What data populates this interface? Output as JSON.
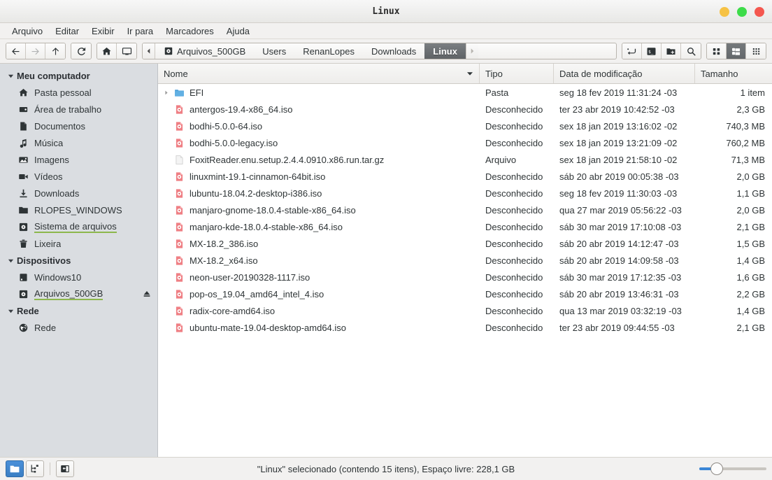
{
  "window": {
    "title": "Linux",
    "controls": [
      {
        "name": "minimize-button",
        "color": "#f6c244"
      },
      {
        "name": "maximize-button",
        "color": "#3ddc4a"
      },
      {
        "name": "close-button",
        "color": "#f4574f"
      }
    ]
  },
  "menubar": {
    "items": [
      {
        "label": "Arquivo"
      },
      {
        "label": "Editar"
      },
      {
        "label": "Exibir"
      },
      {
        "label": "Ir para"
      },
      {
        "label": "Marcadores"
      },
      {
        "label": "Ajuda"
      }
    ]
  },
  "toolbar": {
    "nav": [
      {
        "name": "back-button",
        "icon": "arrow-left-icon",
        "disabled": false
      },
      {
        "name": "forward-button",
        "icon": "arrow-right-icon",
        "disabled": true
      },
      {
        "name": "up-button",
        "icon": "arrow-up-icon",
        "disabled": false
      }
    ],
    "reload": {
      "name": "reload-button",
      "icon": "reload-icon"
    },
    "places": [
      {
        "name": "home-button",
        "icon": "home-icon"
      },
      {
        "name": "desktop-button",
        "icon": "monitor-icon"
      }
    ],
    "breadcrumb": {
      "left_arrow": "chevron-left-icon",
      "right_arrow": "chevron-right-icon",
      "crumbs": [
        {
          "label": "Arquivos_500GB",
          "icon": "drive-icon",
          "current": false
        },
        {
          "label": "Users",
          "icon": "",
          "current": false
        },
        {
          "label": "RenanLopes",
          "icon": "",
          "current": false
        },
        {
          "label": "Downloads",
          "icon": "",
          "current": false
        },
        {
          "label": "Linux",
          "icon": "",
          "current": true
        }
      ]
    },
    "actions": [
      {
        "name": "toggle-location-entry-button",
        "icon": "path-entry-icon"
      },
      {
        "name": "open-terminal-button",
        "icon": "terminal-icon"
      },
      {
        "name": "new-folder-button",
        "icon": "new-folder-icon"
      },
      {
        "name": "search-button",
        "icon": "search-icon"
      }
    ],
    "views": [
      {
        "name": "icon-view-button",
        "icon": "grid-view-icon",
        "active": false
      },
      {
        "name": "list-view-button",
        "icon": "list-view-icon",
        "active": true
      },
      {
        "name": "compact-view-button",
        "icon": "compact-view-icon",
        "active": false
      }
    ]
  },
  "sidebar": {
    "groups": [
      {
        "name": "meu-computador",
        "label": "Meu computador",
        "expanded": true,
        "items": [
          {
            "label": "Pasta pessoal",
            "icon": "home-icon",
            "name": "sidebar-item-pasta-pessoal"
          },
          {
            "label": "Área de trabalho",
            "icon": "desktop-icon",
            "name": "sidebar-item-area-de-trabalho"
          },
          {
            "label": "Documentos",
            "icon": "document-icon",
            "name": "sidebar-item-documentos"
          },
          {
            "label": "Música",
            "icon": "music-note-icon",
            "name": "sidebar-item-musica"
          },
          {
            "label": "Imagens",
            "icon": "image-icon",
            "name": "sidebar-item-imagens"
          },
          {
            "label": "Vídeos",
            "icon": "video-camera-icon",
            "name": "sidebar-item-videos"
          },
          {
            "label": "Downloads",
            "icon": "download-icon",
            "name": "sidebar-item-downloads"
          },
          {
            "label": "RLOPES_WINDOWS",
            "icon": "folder-icon",
            "name": "sidebar-item-rlopes-windows"
          },
          {
            "label": "Sistema de arquivos",
            "icon": "drive-icon",
            "name": "sidebar-item-sistema-de-arquivos",
            "underline": true
          },
          {
            "label": "Lixeira",
            "icon": "trash-icon",
            "name": "sidebar-item-lixeira"
          }
        ]
      },
      {
        "name": "dispositivos",
        "label": "Dispositivos",
        "expanded": true,
        "items": [
          {
            "label": "Windows10",
            "icon": "hdd-icon",
            "name": "sidebar-item-windows10"
          },
          {
            "label": "Arquivos_500GB",
            "icon": "drive-icon",
            "name": "sidebar-item-arquivos-500gb",
            "underline": true,
            "eject": true
          }
        ]
      },
      {
        "name": "rede",
        "label": "Rede",
        "expanded": true,
        "items": [
          {
            "label": "Rede",
            "icon": "globe-icon",
            "name": "sidebar-item-rede"
          }
        ]
      }
    ]
  },
  "filelist": {
    "columns": [
      {
        "label": "Nome",
        "key": "name",
        "sorted": true,
        "sort_dir": "desc"
      },
      {
        "label": "Tipo",
        "key": "type"
      },
      {
        "label": "Data de modificação",
        "key": "modified"
      },
      {
        "label": "Tamanho",
        "key": "size"
      }
    ],
    "rows": [
      {
        "name": "EFI",
        "type": "Pasta",
        "modified": "seg 18 fev 2019 11:31:24 -03",
        "size": "1 item",
        "icon": "folder-icon",
        "expandable": true
      },
      {
        "name": "antergos-19.4-x86_64.iso",
        "type": "Desconhecido",
        "modified": "ter 23 abr 2019 10:42:52 -03",
        "size": "2,3 GB",
        "icon": "iso-icon",
        "expandable": false
      },
      {
        "name": "bodhi-5.0.0-64.iso",
        "type": "Desconhecido",
        "modified": "sex 18 jan 2019 13:16:02 -02",
        "size": "740,3 MB",
        "icon": "iso-icon",
        "expandable": false
      },
      {
        "name": "bodhi-5.0.0-legacy.iso",
        "type": "Desconhecido",
        "modified": "sex 18 jan 2019 13:21:09 -02",
        "size": "760,2 MB",
        "icon": "iso-icon",
        "expandable": false
      },
      {
        "name": "FoxitReader.enu.setup.2.4.4.0910.x86.run.tar.gz",
        "type": "Arquivo",
        "modified": "sex 18 jan 2019 21:58:10 -02",
        "size": "71,3 MB",
        "icon": "archive-icon",
        "expandable": false
      },
      {
        "name": "linuxmint-19.1-cinnamon-64bit.iso",
        "type": "Desconhecido",
        "modified": "sáb 20 abr 2019 00:05:38 -03",
        "size": "2,0 GB",
        "icon": "iso-icon",
        "expandable": false
      },
      {
        "name": "lubuntu-18.04.2-desktop-i386.iso",
        "type": "Desconhecido",
        "modified": "seg 18 fev 2019 11:30:03 -03",
        "size": "1,1 GB",
        "icon": "iso-icon",
        "expandable": false
      },
      {
        "name": "manjaro-gnome-18.0.4-stable-x86_64.iso",
        "type": "Desconhecido",
        "modified": "qua 27 mar 2019 05:56:22 -03",
        "size": "2,0 GB",
        "icon": "iso-icon",
        "expandable": false
      },
      {
        "name": "manjaro-kde-18.0.4-stable-x86_64.iso",
        "type": "Desconhecido",
        "modified": "sáb 30 mar 2019 17:10:08 -03",
        "size": "2,1 GB",
        "icon": "iso-icon",
        "expandable": false
      },
      {
        "name": "MX-18.2_386.iso",
        "type": "Desconhecido",
        "modified": "sáb 20 abr 2019 14:12:47 -03",
        "size": "1,5 GB",
        "icon": "iso-icon",
        "expandable": false
      },
      {
        "name": "MX-18.2_x64.iso",
        "type": "Desconhecido",
        "modified": "sáb 20 abr 2019 14:09:58 -03",
        "size": "1,4 GB",
        "icon": "iso-icon",
        "expandable": false
      },
      {
        "name": "neon-user-20190328-1117.iso",
        "type": "Desconhecido",
        "modified": "sáb 30 mar 2019 17:12:35 -03",
        "size": "1,6 GB",
        "icon": "iso-icon",
        "expandable": false
      },
      {
        "name": "pop-os_19.04_amd64_intel_4.iso",
        "type": "Desconhecido",
        "modified": "sáb 20 abr 2019 13:46:31 -03",
        "size": "2,2 GB",
        "icon": "iso-icon",
        "expandable": false
      },
      {
        "name": "radix-core-amd64.iso",
        "type": "Desconhecido",
        "modified": "qua 13 mar 2019 03:32:19 -03",
        "size": "1,4 GB",
        "icon": "iso-icon",
        "expandable": false
      },
      {
        "name": "ubuntu-mate-19.04-desktop-amd64.iso",
        "type": "Desconhecido",
        "modified": "ter 23 abr 2019 09:44:55 -03",
        "size": "2,1 GB",
        "icon": "iso-icon",
        "expandable": false
      }
    ]
  },
  "statusbar": {
    "buttons": [
      {
        "name": "places-view-button",
        "icon": "folder-icon",
        "active": true
      },
      {
        "name": "tree-view-button",
        "icon": "tree-icon",
        "active": false
      },
      {
        "name": "toggle-sidebar-button",
        "icon": "sidebar-toggle-icon",
        "active": false
      }
    ],
    "text": "\"Linux\" selecionado (contendo 15 itens), Espaço livre: 228,1 GB",
    "zoom": {
      "name": "zoom-slider",
      "value": 20
    }
  },
  "colors": {
    "accent_blue": "#3b86d6",
    "underline_green": "#8db74d",
    "iso_red": "#e8656a",
    "folder_blue": "#4a9fd8",
    "sidebar_bg": "#dadde1",
    "toolbar_bg": "#f2f1f0"
  }
}
